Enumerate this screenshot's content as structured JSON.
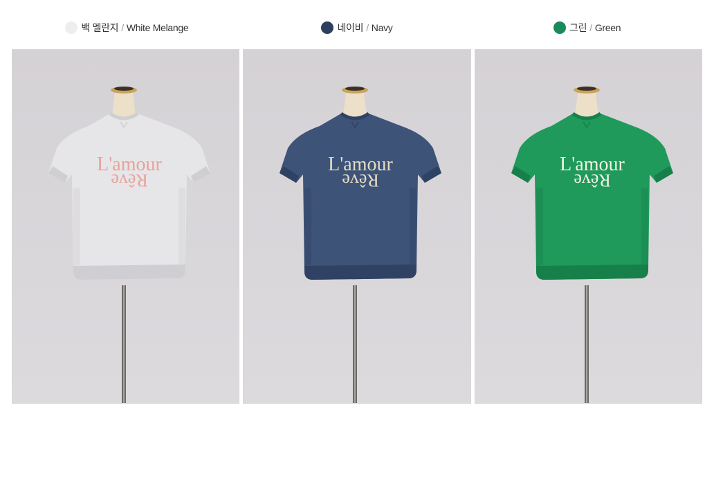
{
  "colors": [
    {
      "kr": "백 멜란지",
      "en": "White Melange",
      "slash": "/",
      "swatch": "#eeeeee"
    },
    {
      "kr": "네이비",
      "en": "Navy",
      "slash": "/",
      "swatch": "#2e3e5e"
    },
    {
      "kr": "그린",
      "en": "Green",
      "slash": "/",
      "swatch": "#1a8a5a"
    }
  ],
  "products": [
    {
      "shirt_color": "#e6e6e8",
      "shirt_shade": "#cfcfd3",
      "print_line1": "L'amour",
      "print_line2": "Rêve",
      "print_color": "#e8a29c"
    },
    {
      "shirt_color": "#3e5378",
      "shirt_shade": "#2f4263",
      "print_line1": "L'amour",
      "print_line2": "Rêve",
      "print_color": "#e6dcc0"
    },
    {
      "shirt_color": "#1f9a5a",
      "shirt_shade": "#17804a",
      "print_line1": "L'amour",
      "print_line2": "Rêve",
      "print_color": "#f4f1e6"
    }
  ]
}
